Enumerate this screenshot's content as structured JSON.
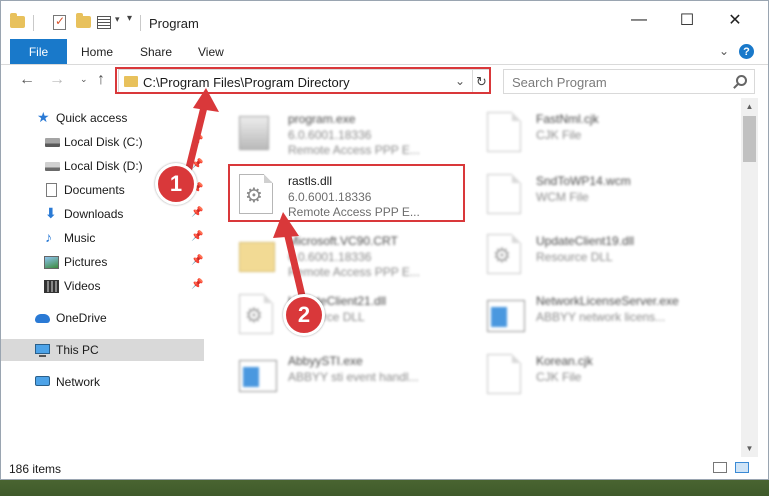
{
  "window": {
    "title": "Program",
    "minimize_glyph": "—",
    "maximize_glyph": "☐",
    "close_glyph": "✕"
  },
  "ribbon": {
    "tabs": [
      {
        "label": "File"
      },
      {
        "label": "Home"
      },
      {
        "label": "Share"
      },
      {
        "label": "View"
      }
    ],
    "help_label": "?"
  },
  "nav": {
    "address": "C:\\Program Files\\Program Directory",
    "search_placeholder": "Search Program"
  },
  "sidebar": {
    "items": [
      {
        "label": "Quick access",
        "icon": "star-icon"
      },
      {
        "label": "Local Disk (C:)",
        "icon": "drive-icon"
      },
      {
        "label": "Local Disk (D:)",
        "icon": "drive-icon"
      },
      {
        "label": "Documents",
        "icon": "documents-icon"
      },
      {
        "label": "Downloads",
        "icon": "download-icon"
      },
      {
        "label": "Music",
        "icon": "music-icon"
      },
      {
        "label": "Pictures",
        "icon": "pictures-icon"
      },
      {
        "label": "Videos",
        "icon": "videos-icon"
      },
      {
        "label": "OneDrive",
        "icon": "cloud-icon"
      },
      {
        "label": "This PC",
        "icon": "computer-icon"
      },
      {
        "label": "Network",
        "icon": "network-icon"
      }
    ]
  },
  "files": [
    {
      "name": "program.exe",
      "line1": "6.0.6001.18336",
      "line2": "Remote Access PPP E..."
    },
    {
      "name": "FastNml.cjk",
      "line1": "CJK File",
      "line2": ""
    },
    {
      "name": "rastls.dll",
      "line1": "6.0.6001.18336",
      "line2": "Remote Access PPP E..."
    },
    {
      "name": "SndToWP14.wcm",
      "line1": "WCM File",
      "line2": ""
    },
    {
      "name": "Microsoft.VC90.CRT",
      "line1": "6.0.6001.18336",
      "line2": "Remote Access PPP E..."
    },
    {
      "name": "UpdateClient19.dll",
      "line1": "Resource DLL",
      "line2": ""
    },
    {
      "name": "UpdateClient21.dll",
      "line1": "Resource DLL",
      "line2": ""
    },
    {
      "name": "NetworkLicenseServer.exe",
      "line1": "ABBYY network licens...",
      "line2": ""
    },
    {
      "name": "AbbyySTI.exe",
      "line1": "ABBYY sti event handl...",
      "line2": ""
    },
    {
      "name": "Korean.cjk",
      "line1": "CJK File",
      "line2": ""
    }
  ],
  "status": {
    "item_count": "186 items"
  },
  "annotations": {
    "badge1": "1",
    "badge2": "2",
    "color": "#d9383a"
  }
}
